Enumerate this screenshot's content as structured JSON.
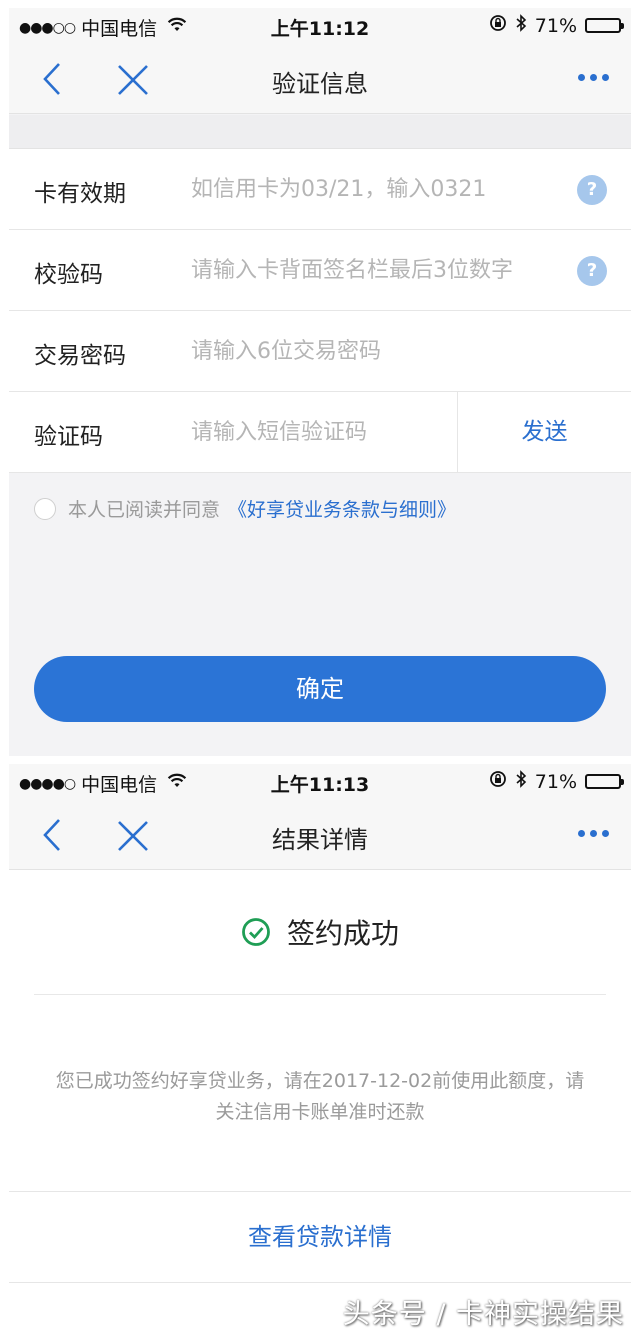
{
  "screen1": {
    "status": {
      "signal": "●●●○○",
      "carrier": "中国电信",
      "time": "上午11:12",
      "battery": "71%"
    },
    "nav": {
      "title": "验证信息"
    },
    "form": {
      "expiry_label": "卡有效期",
      "expiry_placeholder": "如信用卡为03/21，输入0321",
      "cvv_label": "校验码",
      "cvv_placeholder": "请输入卡背面签名栏最后3位数字",
      "password_label": "交易密码",
      "password_placeholder": "请输入6位交易密码",
      "sms_label": "验证码",
      "sms_placeholder": "请输入短信验证码",
      "send_label": "发送",
      "help_glyph": "?"
    },
    "agreement": {
      "text": "本人已阅读并同意",
      "link": "《好享贷业务条款与细则》"
    },
    "confirm_label": "确定"
  },
  "screen2": {
    "status": {
      "signal": "●●●●○",
      "carrier": "中国电信",
      "time": "上午11:13",
      "battery": "71%"
    },
    "nav": {
      "title": "结果详情"
    },
    "result_title": "签约成功",
    "description": "您已成功签约好享贷业务，请在2017-12-02前使用此额度，请关注信用卡账单准时还款",
    "view_link": "查看贷款详情"
  },
  "watermark": "头条号 / 卡神实操结果",
  "colors": {
    "accent": "#2a6fcf",
    "button": "#2b74d6",
    "success": "#1f9e55"
  },
  "icons": [
    "back-arrow-icon",
    "close-icon",
    "more-icon",
    "help-icon",
    "check-circle-icon",
    "wifi-icon",
    "bluetooth-icon",
    "orientation-lock-icon",
    "battery-icon"
  ]
}
